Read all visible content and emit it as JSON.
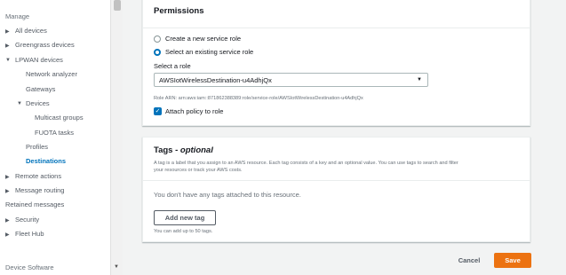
{
  "sidebar": {
    "heading": "Manage",
    "items": [
      {
        "label": "All devices"
      },
      {
        "label": "Greengrass devices"
      },
      {
        "label": "LPWAN devices"
      },
      {
        "label": "Network analyzer"
      },
      {
        "label": "Gateways"
      },
      {
        "label": "Devices"
      },
      {
        "label": "Multicast groups"
      },
      {
        "label": "FUOTA tasks"
      },
      {
        "label": "Profiles"
      },
      {
        "label": "Destinations"
      },
      {
        "label": "Remote actions"
      },
      {
        "label": "Message routing"
      },
      {
        "label": "Retained messages"
      },
      {
        "label": "Security"
      },
      {
        "label": "Fleet Hub"
      }
    ],
    "footer": "Device Software"
  },
  "permissions": {
    "title": "Permissions",
    "radio_new": "Create a new service role",
    "radio_existing": "Select an existing service role",
    "select_label": "Select a role",
    "selected_role": "AWSIotWirelessDestination-u4AdhjQx",
    "role_arn": "Role ARN: arn:aws:iam::871862388389:role/service-role/AWSIotWirelessDestination-u4AdhjQx",
    "attach_policy": "Attach policy to role"
  },
  "tags": {
    "title": "Tags",
    "title_suffix": "- optional",
    "description_line1": "A tag is a label that you assign to an AWS resource. Each tag consists of a key and an optional value. You can use tags to search and filter",
    "description_line2": "your resources or track your AWS costs.",
    "empty_text": "You don't have any tags attached to this resource.",
    "add_button": "Add new tag",
    "limit_text": "You can add up to 50 tags."
  },
  "actions": {
    "cancel": "Cancel",
    "save": "Save"
  },
  "colors": {
    "accent": "#0073bb",
    "primary_button": "#ec7211"
  }
}
